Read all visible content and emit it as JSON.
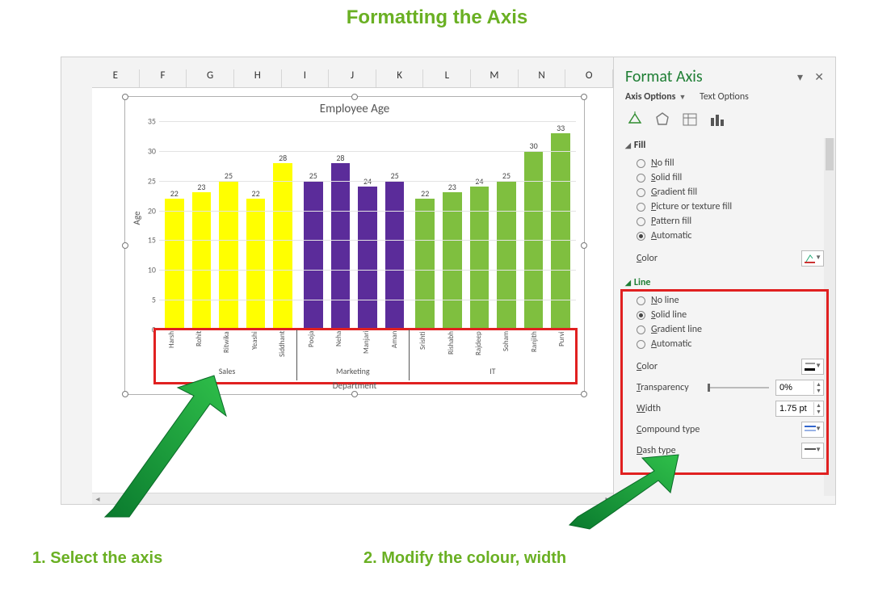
{
  "page": {
    "title": "Formatting the Axis",
    "caption1": "1. Select the axis",
    "caption2": "2. Modify the colour, width"
  },
  "columns": [
    "E",
    "F",
    "G",
    "H",
    "I",
    "J",
    "K",
    "L",
    "M",
    "N",
    "O"
  ],
  "chart_data": {
    "type": "bar",
    "title": "Employee Age",
    "xlabel": "Department",
    "ylabel": "Age",
    "ylim": [
      0,
      35
    ],
    "yticks": [
      0,
      5,
      10,
      15,
      20,
      25,
      30,
      35
    ],
    "groups": [
      {
        "name": "Sales",
        "color": "#FFFF00",
        "items": [
          {
            "name": "Harsh",
            "value": 22
          },
          {
            "name": "Rohit",
            "value": 23
          },
          {
            "name": "Ritwika",
            "value": 25
          },
          {
            "name": "Yeashi",
            "value": 22
          },
          {
            "name": "Siddhant",
            "value": 28
          }
        ]
      },
      {
        "name": "Marketing",
        "color": "#5B2C9A",
        "items": [
          {
            "name": "Pooja",
            "value": 25
          },
          {
            "name": "Neha",
            "value": 28
          },
          {
            "name": "Manjari",
            "value": 24
          },
          {
            "name": "Aman",
            "value": 25
          }
        ]
      },
      {
        "name": "IT",
        "color": "#7FBF3F",
        "items": [
          {
            "name": "Srishti",
            "value": 22
          },
          {
            "name": "Rishabh",
            "value": 23
          },
          {
            "name": "Rajdeep",
            "value": 24
          },
          {
            "name": "Soham",
            "value": 25
          },
          {
            "name": "Ranjith",
            "value": 30
          },
          {
            "name": "Purvi",
            "value": 33
          }
        ]
      }
    ]
  },
  "panel": {
    "title": "Format Axis",
    "tabs": {
      "options": "Axis Options",
      "text": "Text Options"
    },
    "fill": {
      "header": "Fill",
      "options": [
        "No fill",
        "Solid fill",
        "Gradient fill",
        "Picture or texture fill",
        "Pattern fill",
        "Automatic"
      ],
      "selected": "Automatic",
      "color_lbl": "Color"
    },
    "line": {
      "header": "Line",
      "options": [
        "No line",
        "Solid line",
        "Gradient line",
        "Automatic"
      ],
      "selected": "Solid line",
      "color_lbl": "Color",
      "transparency_lbl": "Transparency",
      "transparency_val": "0%",
      "width_lbl": "Width",
      "width_val": "1.75 pt",
      "compound_lbl": "Compound type",
      "dash_lbl": "Dash type"
    }
  }
}
